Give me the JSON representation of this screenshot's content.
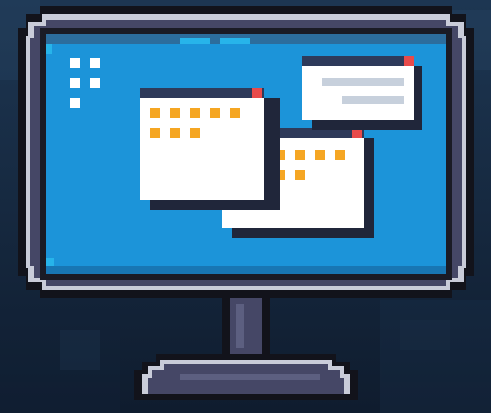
{
  "scene": {
    "subject": "pixel-art-desktop-monitor",
    "icons": [
      "monitor-icon",
      "app-grid-icon",
      "window-icon",
      "close-icon"
    ],
    "windows": [
      {
        "id": "left-window",
        "close_color": "#e84a4a",
        "tiles_color": "#f5a623"
      },
      {
        "id": "middle-window",
        "close_color": "#e84a4a",
        "tiles_color": "#f5a623"
      },
      {
        "id": "right-window",
        "close_color": "#e84a4a",
        "line_color": "#c7d0dc"
      }
    ]
  },
  "colors": {
    "background_top": "#1d3652",
    "background_bottom": "#0f1c2e",
    "frame_dark": "#1a1b25",
    "frame_mid": "#454766",
    "frame_light": "#c9ccd9",
    "screen": "#1c94d9",
    "screen_highlight": "#27b4ea",
    "screen_top_strip": "#2c6d9d",
    "window_white": "#ffffff",
    "window_bar": "#2e3a5a",
    "window_shadow": "#20263a",
    "accent_tile": "#f5a623",
    "close_button": "#e84a4a"
  }
}
